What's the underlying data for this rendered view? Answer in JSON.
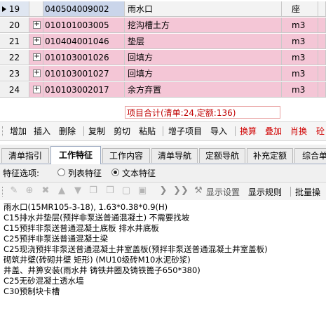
{
  "grid": {
    "rows": [
      {
        "num": "19",
        "code": "040504009002",
        "name": "雨水口",
        "unit": "座",
        "selected": true
      },
      {
        "num": "20",
        "code": "010101003005",
        "name": "挖沟槽土方",
        "unit": "m3"
      },
      {
        "num": "21",
        "code": "010404001046",
        "name": "垫层",
        "unit": "m3"
      },
      {
        "num": "22",
        "code": "010103001026",
        "name": "回填方",
        "unit": "m3"
      },
      {
        "num": "23",
        "code": "010103001027",
        "name": "回填方",
        "unit": "m3"
      },
      {
        "num": "24",
        "code": "010103002017",
        "name": "余方弃置",
        "unit": "m3"
      }
    ],
    "expander_glyph": "+"
  },
  "summary": "项目合计(清单:24,定额:136)",
  "toolbar": {
    "items": [
      "增加",
      "插入",
      "删除",
      "复制",
      "剪切",
      "粘贴",
      "增子项目",
      "导入",
      "换算",
      "叠加",
      "肖换",
      "砼"
    ],
    "accent_color": "#d00000"
  },
  "tabs": [
    "清单指引",
    "工作特征",
    "工作内容",
    "清单导航",
    "定额导航",
    "补充定额",
    "综合单"
  ],
  "active_tab": "工作特征",
  "options": {
    "label": "特征选项:",
    "radio_list": "列表特征",
    "radio_text": "文本特征",
    "selected": "文本特征"
  },
  "subtoolbar": {
    "icons": [
      "edit-icon",
      "add-icon",
      "delete-icon",
      "up-icon",
      "down-icon",
      "copy-icon",
      "copy2-icon",
      "paste-icon",
      "paste2-icon",
      "next-icon",
      "last-icon",
      "hammer-icon"
    ],
    "display_settings": "显示设置",
    "display_rules": "显示规则",
    "batch_ops": "批量操作"
  },
  "text_lines": [
    "雨水口(15MR105-3-18), 1.63*0.38*0.9(H)",
    "C15排水井垫层(预拌非泵送普通混凝土) 不需要找坡",
    "C15预拌非泵送普通混凝土底板 排水井底板",
    "C25预拌非泵送普通混凝土梁",
    "C25现浇预拌非泵送普通混凝土井室盖板(预拌非泵送普通混凝土井室盖板)",
    "砌筑井壁(砖砌井壁 矩形) (MU10级砖M10水泥砂浆)",
    "井盖、井箅安装(雨水井 铸铁井圈及铸铁篦子650*380)",
    "C25无砂混凝土透水墙",
    "C30预制块卡槽"
  ]
}
